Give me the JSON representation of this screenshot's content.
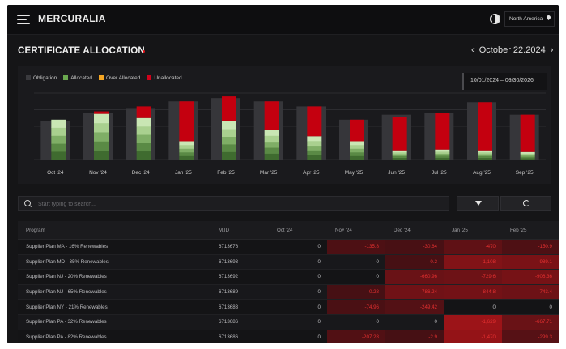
{
  "app": {
    "brand": "MERCURALIA",
    "region": "North America"
  },
  "page": {
    "title": "CERTIFICATE ALLOCATION",
    "period": "October 22.2024"
  },
  "legend": [
    {
      "label": "Obligation",
      "color": "#3a3a3e"
    },
    {
      "label": "Allocated",
      "color": "#6aa84f"
    },
    {
      "label": "Over Allocated",
      "color": "#f5a623"
    },
    {
      "label": "Unallocated",
      "color": "#d0021b"
    }
  ],
  "date_range": "10/01/2024 – 09/30/2026",
  "chart_data": {
    "type": "bar",
    "categories": [
      "Oct '24",
      "Nov '24",
      "Dec '24",
      "Jan '25",
      "Feb '25",
      "Mar '25",
      "Apr '25",
      "May '25",
      "Jun '25",
      "Jul '25",
      "Aug '25",
      "Sep '25"
    ],
    "series": [
      {
        "name": "Obligation",
        "values": [
          46,
          56,
          62,
          70,
          74,
          70,
          64,
          48,
          54,
          56,
          69,
          54
        ]
      },
      {
        "name": "Allocated",
        "values": [
          48,
          55,
          50,
          22,
          46,
          36,
          28,
          22,
          11,
          12,
          11,
          9
        ]
      },
      {
        "name": "Unallocated",
        "values": [
          0,
          3,
          14,
          48,
          30,
          34,
          36,
          26,
          40,
          44,
          58,
          45
        ]
      }
    ],
    "ylim": [
      0,
      80
    ],
    "grid": true,
    "legend": "top-left"
  },
  "search": {
    "placeholder": "Start typing to search..."
  },
  "table": {
    "columns": [
      "Program",
      "M.ID",
      "Oct '24",
      "Nov '24",
      "Dec '24",
      "Jan '25",
      "Feb '25"
    ],
    "rows": [
      {
        "program": "Supplier Plan MA - 16% Renewables",
        "mid": "6713676",
        "values": [
          "0",
          "-135.8",
          "-30.64",
          "-470",
          "-150.9"
        ]
      },
      {
        "program": "Supplier Plan MD - 35% Renewables",
        "mid": "6713693",
        "values": [
          "0",
          "0",
          "-0.2",
          "-1,108",
          "-989.1"
        ]
      },
      {
        "program": "Supplier Plan NJ - 20% Renewables",
        "mid": "6713692",
        "values": [
          "0",
          "0",
          "-660.96",
          "-729.6",
          "-906.36"
        ]
      },
      {
        "program": "Supplier Plan NJ - 65% Renewables",
        "mid": "6713689",
        "values": [
          "0",
          "0.28",
          "-786.24",
          "-844.8",
          "-743.4"
        ]
      },
      {
        "program": "Supplier Plan NY - 21% Renewables",
        "mid": "6713683",
        "values": [
          "0",
          "-74.96",
          "-249.42",
          "0",
          "0"
        ]
      },
      {
        "program": "Supplier Plan PA - 32% Renewables",
        "mid": "6713686",
        "values": [
          "0",
          "0",
          "0",
          "-1,629",
          "-667.71"
        ]
      },
      {
        "program": "Supplier Plan PA - 82% Renewables",
        "mid": "6713686",
        "values": [
          "0",
          "-207.28",
          "-2.9",
          "-1,470",
          "-299.3"
        ]
      }
    ]
  }
}
